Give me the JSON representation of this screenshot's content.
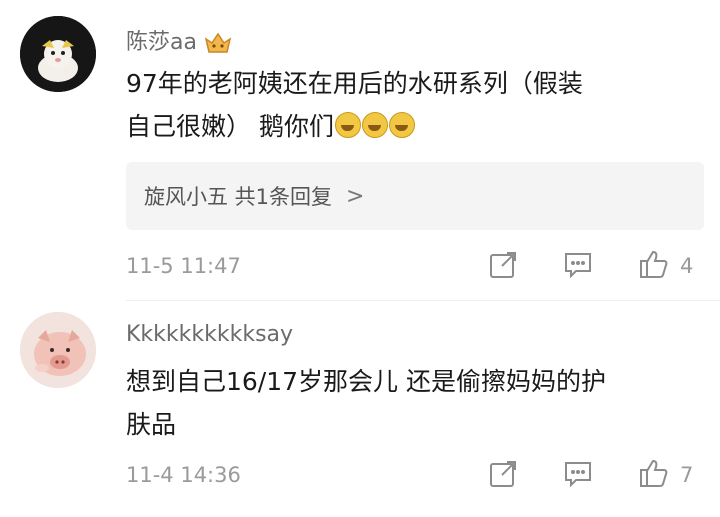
{
  "comments": [
    {
      "username": "陈莎aa",
      "text_line1": "97年的老阿姨还在用后的水研系列（假装",
      "text_line2": "自己很嫩） 鹅你们",
      "reply_summary": "旋风小五  共1条回复",
      "reply_chevron": ">",
      "time": "11-5 11:47",
      "like_count": "4",
      "icons": [
        "crown-badge-icon",
        "laugh-emoji-icon",
        "share-icon",
        "comment-icon",
        "thumbs-up-icon",
        "chevron-right-icon"
      ]
    },
    {
      "username": "Kkkkkkkkkksay",
      "text_line1": "想到自己16/17岁那会儿 还是偷擦妈妈的护",
      "text_line2": "肤品",
      "time": "11-4 14:36",
      "like_count": "7",
      "icons": [
        "share-icon",
        "comment-icon",
        "thumbs-up-icon"
      ]
    }
  ],
  "colors": {
    "meta": "#9a9a9a",
    "username": "#6b6b6b",
    "reply_bg": "#f4f4f5"
  }
}
